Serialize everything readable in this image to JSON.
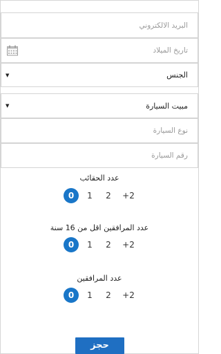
{
  "form": {
    "email_placeholder": "البريد الالكتروني",
    "birthdate_placeholder": "تاريخ الميلاد",
    "gender_value": "الجنس",
    "car_parking_value": "مبيت السيارة",
    "car_type_placeholder": "نوع السيارة",
    "car_number_placeholder": "رقم السيارة"
  },
  "bags": {
    "title": "عدد الحقائب",
    "options": [
      "0",
      "1",
      "2",
      "+2"
    ],
    "selected": "0"
  },
  "companions_under16": {
    "title": "عدد المرافقين اقل من 16 سنة",
    "options": [
      "0",
      "1",
      "2",
      "+2"
    ],
    "selected": "0"
  },
  "companions": {
    "title": "عدد المرافقين",
    "options": [
      "0",
      "1",
      "2",
      "+2"
    ],
    "selected": "0"
  },
  "actions": {
    "book_label": "حجز"
  },
  "icons": {
    "calendar": "calendar-icon",
    "dropdown": "caret-down-icon"
  },
  "colors": {
    "accent": "#1976c8",
    "button": "#1f6fc2"
  }
}
